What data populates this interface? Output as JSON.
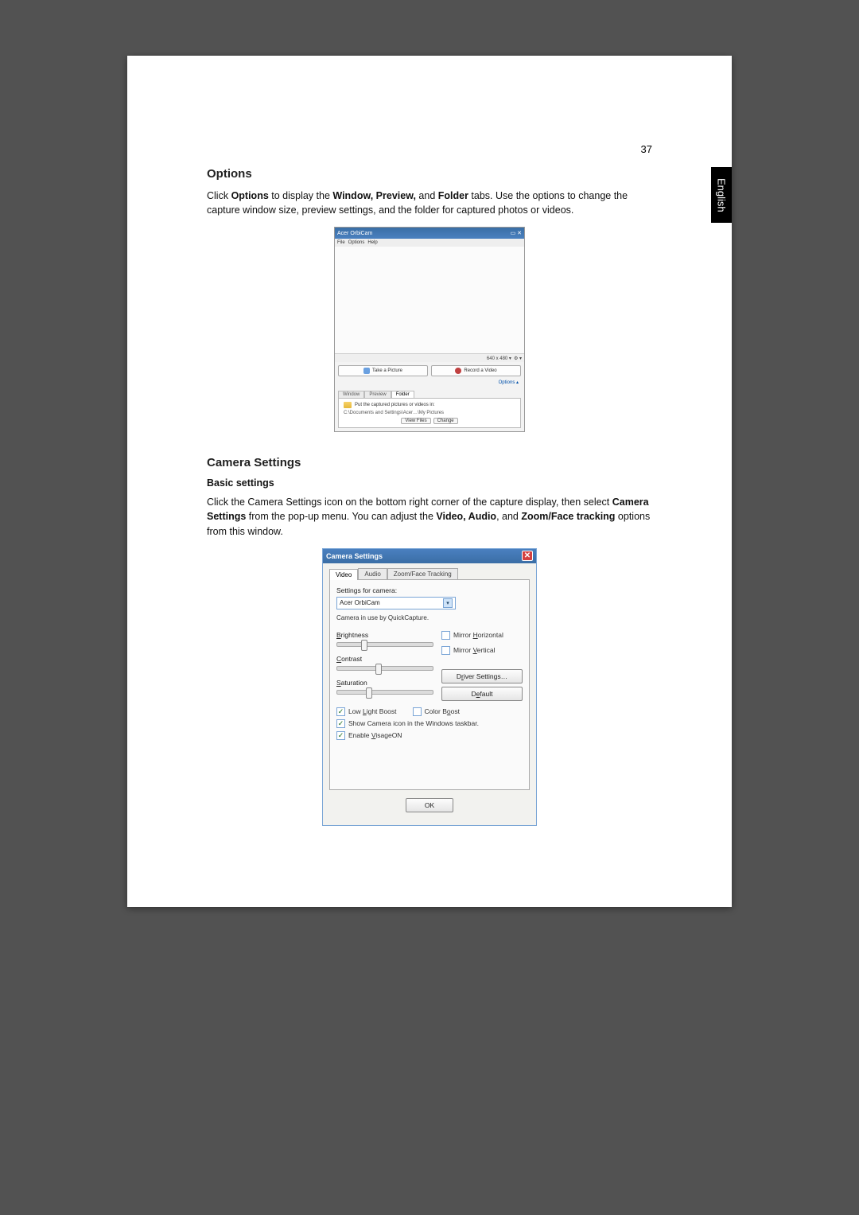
{
  "page_number": "37",
  "side_tab": "English",
  "section1": {
    "heading": "Options",
    "para": [
      "Click ",
      "Options",
      " to display the ",
      "Window, Preview,",
      " and ",
      "Folder",
      " tabs. Use the options to change the capture window size, preview settings, and the folder for captured photos or videos."
    ]
  },
  "shot1": {
    "title": "Acer OrbiCam",
    "menu": [
      "File",
      "Options",
      "Help"
    ],
    "status_res": "640 x 480 ▾",
    "status_icon": "⚙ ▾",
    "take_picture": "Take a Picture",
    "record_video": "Record a Video",
    "options_link": "Options  ▴",
    "tabs": [
      "Window",
      "Preview",
      "Folder"
    ],
    "active_tab": 2,
    "folder_label": "Put the captured pictures or videos in:",
    "folder_path": "C:\\Documents and Settings\\Acer…\\My Pictures",
    "view_files": "View Files",
    "change": "Change"
  },
  "section2": {
    "heading": "Camera Settings",
    "sub": "Basic settings",
    "para": [
      "Click the Camera Settings icon on the bottom right corner of the capture display, then select ",
      "Camera Settings",
      " from the pop-up menu. You can adjust the ",
      "Video, Audio",
      ", and ",
      "Zoom/Face tracking",
      " options from this window."
    ]
  },
  "shot2": {
    "title": "Camera Settings",
    "tabs": [
      "Video",
      "Audio",
      "Zoom/Face Tracking"
    ],
    "active_tab": 0,
    "settings_for": "Settings for camera:",
    "camera_name": "Acer OrbiCam",
    "in_use": "Camera in use by QuickCapture.",
    "brightness": "Brightness",
    "contrast": "Contrast",
    "saturation": "Saturation",
    "mirror_h": "Mirror Horizontal",
    "mirror_v": "Mirror Vertical",
    "driver_settings": "Driver Settings…",
    "default": "Default",
    "low_light": "Low Light Boost",
    "color_boost": "Color Boost",
    "show_icon": "Show Camera icon in the Windows taskbar.",
    "enable_visageon": "Enable VisageON",
    "ok": "OK",
    "slider_positions": {
      "brightness": 25,
      "contrast": 40,
      "saturation": 30
    },
    "checked": {
      "low_light": true,
      "color_boost": false,
      "show_icon": true,
      "enable_visageon": true,
      "mirror_h": false,
      "mirror_v": false
    }
  }
}
